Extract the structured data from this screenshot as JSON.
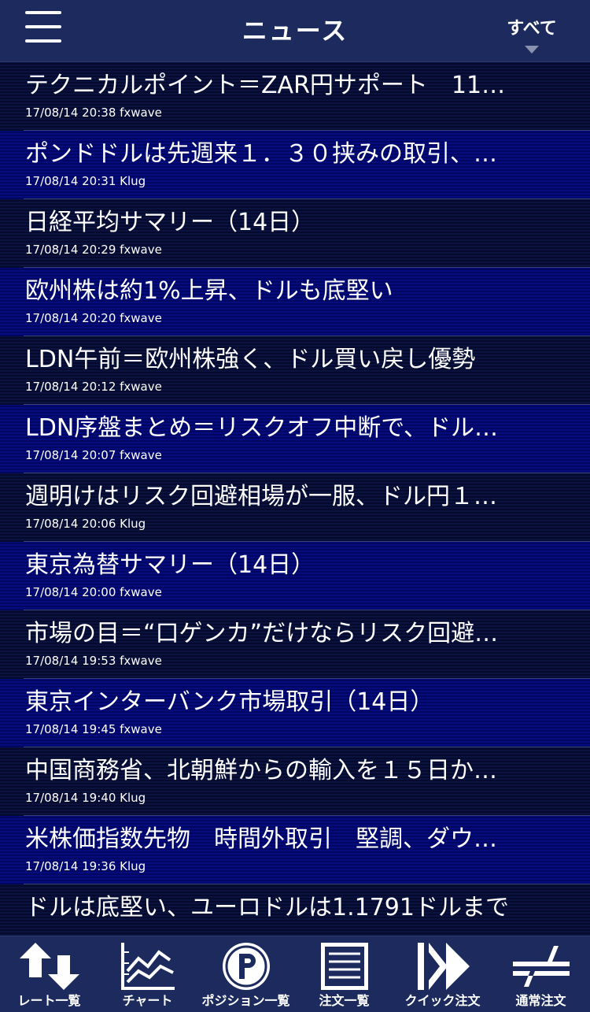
{
  "header": {
    "title": "ニュース",
    "filter_label": "すべて",
    "menu_icon": "hamburger-menu-icon",
    "filter_icon": "dropdown-arrow-icon"
  },
  "news": [
    {
      "title": "テクニカルポイント＝ZAR円サポート　11…",
      "meta": "17/08/14 20:38 fxwave"
    },
    {
      "title": "ポンドドルは先週来１．３０挟みの取引、…",
      "meta": "17/08/14 20:31 Klug"
    },
    {
      "title": "日経平均サマリー（14日）",
      "meta": "17/08/14 20:29 fxwave"
    },
    {
      "title": "欧州株は約1%上昇、ドルも底堅い",
      "meta": "17/08/14 20:20 fxwave"
    },
    {
      "title": "LDN午前＝欧州株強く、ドル買い戻し優勢",
      "meta": "17/08/14 20:12 fxwave"
    },
    {
      "title": "LDN序盤まとめ＝リスクオフ中断で、ドル…",
      "meta": "17/08/14 20:07 fxwave"
    },
    {
      "title": "週明けはリスク回避相場が一服、ドル円１…",
      "meta": "17/08/14 20:06 Klug"
    },
    {
      "title": "東京為替サマリー（14日）",
      "meta": "17/08/14 20:00 fxwave"
    },
    {
      "title": "市場の目＝“口ゲンカ”だけならリスク回避…",
      "meta": "17/08/14 19:53 fxwave"
    },
    {
      "title": "東京インターバンク市場取引（14日）",
      "meta": "17/08/14 19:45 fxwave"
    },
    {
      "title": "中国商務省、北朝鮮からの輸入を１５日か…",
      "meta": "17/08/14 19:40 Klug"
    },
    {
      "title": "米株価指数先物　時間外取引　堅調、ダウ…",
      "meta": "17/08/14 19:36 Klug"
    },
    {
      "title": "ドルは底堅い、ユーロドルは1.1791ドルまで",
      "meta": ""
    }
  ],
  "tabs": [
    {
      "label": "レート一覧",
      "icon": "rate-list-arrows-icon"
    },
    {
      "label": "チャート",
      "icon": "chart-icon"
    },
    {
      "label": "ポジション一覧",
      "icon": "position-p-icon"
    },
    {
      "label": "注文一覧",
      "icon": "order-list-icon"
    },
    {
      "label": "クイック注文",
      "icon": "quick-order-icon"
    },
    {
      "label": "通常注文",
      "icon": "normal-order-icon"
    }
  ]
}
